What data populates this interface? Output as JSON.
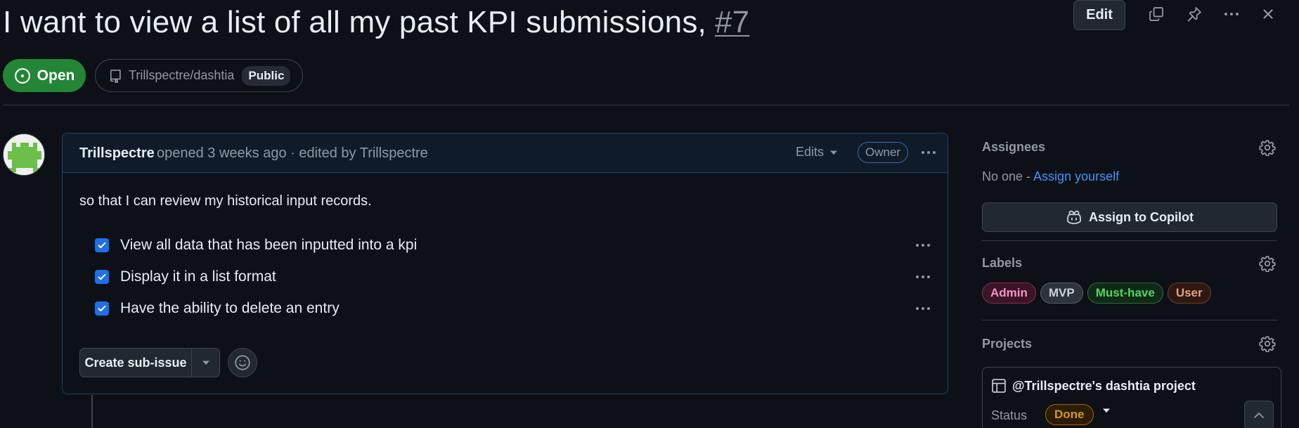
{
  "issue": {
    "title": "I want to view a list of all my past KPI submissions,",
    "number": "#7",
    "state": "Open"
  },
  "header_actions": {
    "edit_label": "Edit",
    "icons": [
      "copy-icon",
      "pin-icon",
      "more-icon",
      "close-icon"
    ]
  },
  "repo": {
    "name": "Trillspectre/dashtia",
    "visibility": "Public"
  },
  "comment": {
    "author": "Trillspectre",
    "meta": "opened 3 weeks ago · edited by Trillspectre",
    "edits_label": "Edits",
    "role_badge": "Owner",
    "body": "so that I can review my historical input records.",
    "tasks": [
      {
        "label": "View all data that has been inputted into a kpi",
        "checked": true
      },
      {
        "label": "Display it in a list format",
        "checked": true
      },
      {
        "label": "Have the ability to delete an entry",
        "checked": true
      }
    ],
    "create_subissue_label": "Create sub-issue"
  },
  "sidebar": {
    "assignees": {
      "title": "Assignees",
      "none_text": "No one - ",
      "assign_yourself": "Assign yourself",
      "copilot_button": "Assign to Copilot"
    },
    "labels": {
      "title": "Labels",
      "items": [
        {
          "name": "Admin",
          "color": "#f692c8",
          "bg": "#3b1427",
          "border": "#7e2f57"
        },
        {
          "name": "MVP",
          "color": "#c9d1d9",
          "bg": "#2d333b",
          "border": "#545d68"
        },
        {
          "name": "Must-have",
          "color": "#56d364",
          "bg": "#0f2a17",
          "border": "#2e6b3a"
        },
        {
          "name": "User",
          "color": "#e7a086",
          "bg": "#2e1912",
          "border": "#6b3c2b"
        }
      ]
    },
    "projects": {
      "title": "Projects",
      "project_name": "@Trillspectre's dashtia project",
      "status_label": "Status",
      "status_value": "Done"
    }
  }
}
